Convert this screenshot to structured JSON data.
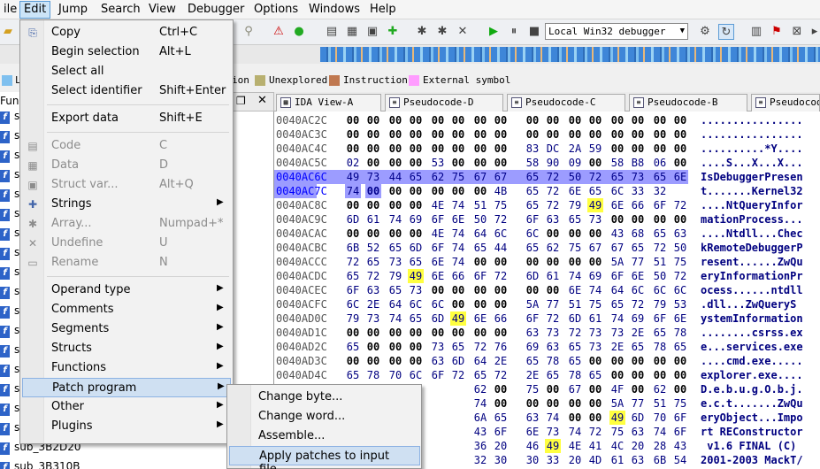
{
  "menubar": {
    "items": [
      "ile",
      "Edit",
      "Jump",
      "Search",
      "View",
      "Debugger",
      "Options",
      "Windows",
      "Help"
    ]
  },
  "toolbar": {
    "debugger": "Local Win32 debugger"
  },
  "legend": [
    {
      "label": "L",
      "color": "#7fc0ef"
    },
    {
      "label": "ion",
      "color": "#7fc0ef"
    },
    {
      "label": "Unexplored",
      "color": "#b8b070"
    },
    {
      "label": "Instruction",
      "color": "#c07850"
    },
    {
      "label": "External symbol",
      "color": "#ff9cff"
    }
  ],
  "tabs": [
    "IDA View-A",
    "Pseudocode-D",
    "Pseudocode-C",
    "Pseudocode-B",
    "Pseudocod"
  ],
  "functions_header": "Func",
  "functions": [
    {
      "label": "s"
    },
    {
      "label": "s"
    },
    {
      "label": "s"
    },
    {
      "label": "s"
    },
    {
      "label": "s"
    },
    {
      "label": "s"
    },
    {
      "label": "s"
    },
    {
      "label": "s"
    },
    {
      "label": "s"
    },
    {
      "label": "s"
    },
    {
      "label": "s"
    },
    {
      "label": "s"
    },
    {
      "label": "s"
    },
    {
      "label": "s"
    },
    {
      "label": "s"
    },
    {
      "label": "s"
    },
    {
      "label": "s"
    },
    {
      "label": "sub_3B2D20"
    },
    {
      "label": "sub_3B310B"
    }
  ],
  "edit_menu": [
    {
      "label": "Copy",
      "shortcut": "Ctrl+C",
      "icon": "copy-icon",
      "glyph": "⎘"
    },
    {
      "label": "Begin selection",
      "shortcut": "Alt+L"
    },
    {
      "label": "Select all",
      "shortcut": ""
    },
    {
      "label": "Select identifier",
      "shortcut": "Shift+Enter"
    },
    {
      "sep": true
    },
    {
      "label": "Export data",
      "shortcut": "Shift+E"
    },
    {
      "sep": true
    },
    {
      "label": "Code",
      "shortcut": "C",
      "disabled": true,
      "icon": "code-icon",
      "glyph": "▤"
    },
    {
      "label": "Data",
      "shortcut": "D",
      "disabled": true,
      "icon": "data-icon",
      "glyph": "▦"
    },
    {
      "label": "Struct var...",
      "shortcut": "Alt+Q",
      "disabled": true,
      "icon": "struct-icon",
      "glyph": "▣"
    },
    {
      "label": "Strings",
      "shortcut": "",
      "submenu": true,
      "icon": "strings-icon",
      "glyph": "✚"
    },
    {
      "label": "Array...",
      "shortcut": "Numpad+*",
      "disabled": true,
      "icon": "array-icon",
      "glyph": "✱"
    },
    {
      "label": "Undefine",
      "shortcut": "U",
      "disabled": true,
      "icon": "undefine-icon",
      "glyph": "✕"
    },
    {
      "label": "Rename",
      "shortcut": "N",
      "disabled": true,
      "icon": "rename-icon",
      "glyph": "▭"
    },
    {
      "sep": true
    },
    {
      "label": "Operand type",
      "shortcut": "",
      "submenu": true
    },
    {
      "label": "Comments",
      "shortcut": "",
      "submenu": true
    },
    {
      "label": "Segments",
      "shortcut": "",
      "submenu": true
    },
    {
      "label": "Structs",
      "shortcut": "",
      "submenu": true
    },
    {
      "label": "Functions",
      "shortcut": "",
      "submenu": true
    },
    {
      "label": "Patch program",
      "shortcut": "",
      "submenu": true,
      "highlighted": true
    },
    {
      "label": "Other",
      "shortcut": "",
      "submenu": true
    },
    {
      "label": "Plugins",
      "shortcut": "",
      "submenu": true
    }
  ],
  "patch_submenu": [
    {
      "label": "Change byte..."
    },
    {
      "label": "Change word..."
    },
    {
      "label": "Assemble..."
    },
    {
      "label": "Apply patches to input file...",
      "highlighted": true
    }
  ],
  "hex_rows": [
    {
      "addr": "0040AC2C",
      "bytes": [
        "00",
        "00",
        "00",
        "00",
        "00",
        "00",
        "00",
        "00",
        "00",
        "00",
        "00",
        "00",
        "00",
        "00",
        "00",
        "00"
      ],
      "ascii": "................"
    },
    {
      "addr": "0040AC3C",
      "bytes": [
        "00",
        "00",
        "00",
        "00",
        "00",
        "00",
        "00",
        "00",
        "00",
        "00",
        "00",
        "00",
        "00",
        "00",
        "00",
        "00"
      ],
      "ascii": "................"
    },
    {
      "addr": "0040AC4C",
      "bytes": [
        "00",
        "00",
        "00",
        "00",
        "00",
        "00",
        "00",
        "00",
        "83",
        "DC",
        "2A",
        "59",
        "00",
        "00",
        "00",
        "00"
      ],
      "ascii": "..........*Y...."
    },
    {
      "addr": "0040AC5C",
      "bytes": [
        "02",
        "00",
        "00",
        "00",
        "53",
        "00",
        "00",
        "00",
        "58",
        "90",
        "09",
        "00",
        "58",
        "B8",
        "06",
        "00"
      ],
      "ascii": "....S...X...X..."
    },
    {
      "addr": "0040AC6C",
      "bytes": [
        "49",
        "73",
        "44",
        "65",
        "62",
        "75",
        "67",
        "67",
        "65",
        "72",
        "50",
        "72",
        "65",
        "73",
        "65",
        "6E"
      ],
      "ascii": "IsDebuggerPresen",
      "selected": true
    },
    {
      "addr": "0040AC7C",
      "bytes": [
        "74",
        "00",
        "00",
        "00",
        "00",
        "00",
        "00",
        "4B",
        "65",
        "72",
        "6E",
        "65",
        "6C",
        "33",
        "32"
      ],
      "ascii": "t.......Kernel32",
      "partsel": true
    },
    {
      "addr": "0040AC8C",
      "bytes": [
        "00",
        "00",
        "00",
        "00",
        "4E",
        "74",
        "51",
        "75",
        "65",
        "72",
        "79",
        "49",
        "6E",
        "66",
        "6F",
        "72"
      ],
      "ascii": "....NtQueryInfor"
    },
    {
      "addr": "0040AC9C",
      "bytes": [
        "6D",
        "61",
        "74",
        "69",
        "6F",
        "6E",
        "50",
        "72",
        "6F",
        "63",
        "65",
        "73",
        "00",
        "00",
        "00",
        "00"
      ],
      "ascii": "mationProcess..."
    },
    {
      "addr": "0040ACAC",
      "bytes": [
        "00",
        "00",
        "00",
        "00",
        "4E",
        "74",
        "64",
        "6C",
        "6C",
        "00",
        "00",
        "00",
        "43",
        "68",
        "65",
        "63"
      ],
      "ascii": "....Ntdll...Chec"
    },
    {
      "addr": "0040ACBC",
      "bytes": [
        "6B",
        "52",
        "65",
        "6D",
        "6F",
        "74",
        "65",
        "44",
        "65",
        "62",
        "75",
        "67",
        "67",
        "65",
        "72",
        "50"
      ],
      "ascii": "kRemoteDebuggerP"
    },
    {
      "addr": "0040ACCC",
      "bytes": [
        "72",
        "65",
        "73",
        "65",
        "6E",
        "74",
        "00",
        "00",
        "00",
        "00",
        "00",
        "00",
        "5A",
        "77",
        "51",
        "75"
      ],
      "ascii": "resent......ZwQu"
    },
    {
      "addr": "0040ACDC",
      "bytes": [
        "65",
        "72",
        "79",
        "49",
        "6E",
        "66",
        "6F",
        "72",
        "6D",
        "61",
        "74",
        "69",
        "6F",
        "6E",
        "50",
        "72"
      ],
      "ascii": "eryInformationPr"
    },
    {
      "addr": "0040ACEC",
      "bytes": [
        "6F",
        "63",
        "65",
        "73",
        "00",
        "00",
        "00",
        "00",
        "00",
        "00",
        "6E",
        "74",
        "64",
        "6C",
        "6C",
        "6C"
      ],
      "ascii": "ocess......ntdll"
    },
    {
      "addr": "0040ACFC",
      "bytes": [
        "6C",
        "2E",
        "64",
        "6C",
        "6C",
        "00",
        "00",
        "00",
        "5A",
        "77",
        "51",
        "75",
        "65",
        "72",
        "79",
        "53"
      ],
      "ascii": ".dll...ZwQueryS"
    },
    {
      "addr": "0040AD0C",
      "bytes": [
        "79",
        "73",
        "74",
        "65",
        "6D",
        "49",
        "6E",
        "66",
        "6F",
        "72",
        "6D",
        "61",
        "74",
        "69",
        "6F",
        "6E"
      ],
      "ascii": "ystemInformation"
    },
    {
      "addr": "0040AD1C",
      "bytes": [
        "00",
        "00",
        "00",
        "00",
        "00",
        "00",
        "00",
        "00",
        "63",
        "73",
        "72",
        "73",
        "73",
        "2E",
        "65",
        "78"
      ],
      "ascii": "........csrss.ex"
    },
    {
      "addr": "0040AD2C",
      "bytes": [
        "65",
        "00",
        "00",
        "00",
        "73",
        "65",
        "72",
        "76",
        "69",
        "63",
        "65",
        "73",
        "2E",
        "65",
        "78",
        "65"
      ],
      "ascii": "e...services.exe"
    },
    {
      "addr": "0040AD3C",
      "bytes": [
        "00",
        "00",
        "00",
        "00",
        "63",
        "6D",
        "64",
        "2E",
        "65",
        "78",
        "65",
        "00",
        "00",
        "00",
        "00",
        "00"
      ],
      "ascii": "....cmd.exe....."
    },
    {
      "addr": "0040AD4C",
      "bytes": [
        "65",
        "78",
        "70",
        "6C",
        "6F",
        "72",
        "65",
        "72",
        "2E",
        "65",
        "78",
        "65",
        "00",
        "00",
        "00",
        "00"
      ],
      "ascii": "explorer.exe...."
    },
    {
      "addr": "0040AD5C",
      "bytes": [
        "",
        "",
        "",
        "",
        "",
        "",
        "62",
        "00",
        "75",
        "00",
        "67",
        "00",
        "4F",
        "00",
        "62",
        "00"
      ],
      "ascii": "D.e.b.u.g.O.b.j."
    },
    {
      "addr": "0040AD6C",
      "bytes": [
        "",
        "",
        "",
        "",
        "",
        "",
        "74",
        "00",
        "00",
        "00",
        "00",
        "00",
        "5A",
        "77",
        "51",
        "75"
      ],
      "ascii": "e.c.t.......ZwQu"
    },
    {
      "addr": "0040AD7C",
      "bytes": [
        "",
        "",
        "",
        "",
        "",
        "",
        "6A",
        "65",
        "63",
        "74",
        "00",
        "00",
        "49",
        "6D",
        "70",
        "6F"
      ],
      "ascii": "eryObject...Impo"
    },
    {
      "addr": "0040AD8C",
      "bytes": [
        "",
        "",
        "",
        "",
        "",
        "",
        "43",
        "6F",
        "6E",
        "73",
        "74",
        "72",
        "75",
        "63",
        "74",
        "6F"
      ],
      "ascii": "rt REConstructor"
    },
    {
      "addr": "0040AD9C",
      "bytes": [
        "",
        "",
        "",
        "",
        "",
        "",
        "36",
        "20",
        "46",
        "49",
        "4E",
        "41",
        "4C",
        "20",
        "28",
        "43"
      ],
      "ascii": " v1.6 FINAL (C)"
    },
    {
      "addr": "0040ADAC",
      "bytes": [
        "",
        "",
        "",
        "",
        "",
        "",
        "32",
        "30",
        "30",
        "33",
        "20",
        "4D",
        "61",
        "63",
        "6B",
        "54"
      ],
      "ascii": "2001-2003 MackT/"
    }
  ]
}
